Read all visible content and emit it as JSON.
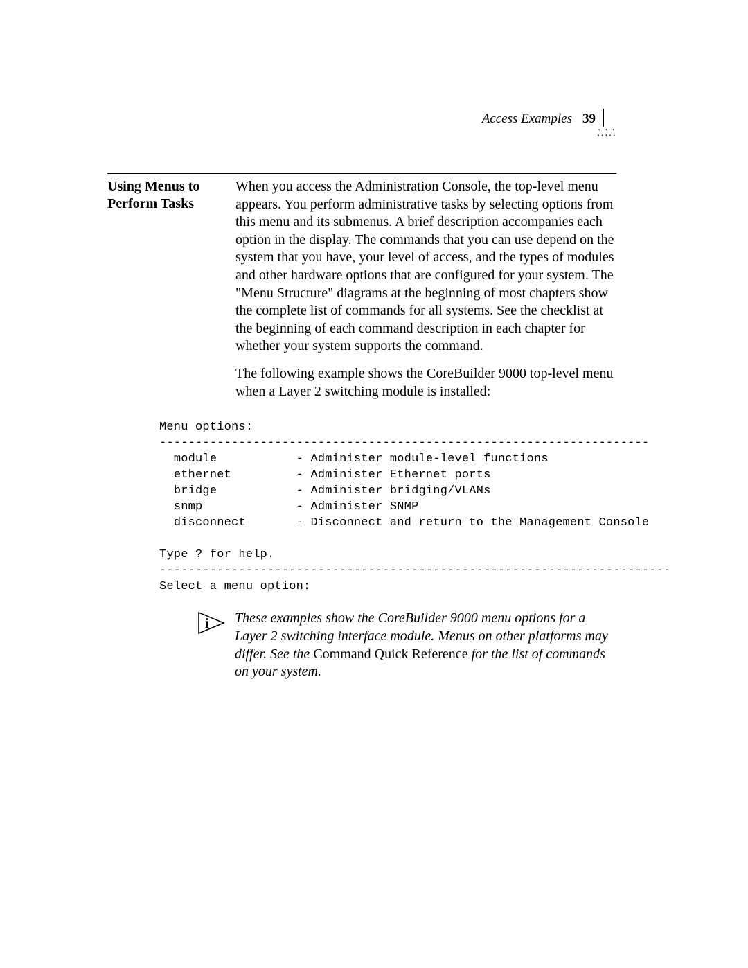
{
  "header": {
    "section": "Access Examples",
    "page": "39"
  },
  "sideHeading": {
    "line1": "Using Menus to",
    "line2": "Perform Tasks"
  },
  "body": {
    "p1": "When you access the Administration Console, the top-level menu appears. You perform administrative tasks by selecting options from this menu and its submenus. A brief description accompanies each option in the display. The commands that you can use depend on the system that you have, your level of access, and the types of modules and other hardware options that are configured for your system.  The \"Menu Structure\" diagrams at the beginning of most chapters show the complete list of commands for all systems. See the checklist at the beginning of each command description in each chapter for whether your system supports the command.",
    "p2": "The following example shows the CoreBuilder 9000 top-level menu when a Layer 2 switching module is installed:"
  },
  "menu": {
    "title": "Menu options:",
    "rule1": "--------------------------------------------------------------------",
    "items": [
      {
        "name": "module",
        "desc": "- Administer module-level functions"
      },
      {
        "name": "ethernet",
        "desc": "- Administer Ethernet ports"
      },
      {
        "name": "bridge",
        "desc": "- Administer bridging/VLANs"
      },
      {
        "name": "snmp",
        "desc": "- Administer SNMP"
      },
      {
        "name": "disconnect",
        "desc": "- Disconnect and return to the Management Console"
      }
    ],
    "help": "Type ? for help.",
    "rule2": "-----------------------------------------------------------------------",
    "prompt": "Select a menu option:"
  },
  "note": {
    "t1": "These examples show the CoreBuilder 9000 menu options for a Layer 2 switching interface module. Menus on other platforms may differ. See the ",
    "t2": "Command Quick Reference",
    "t3": " for the list of commands on your system."
  }
}
